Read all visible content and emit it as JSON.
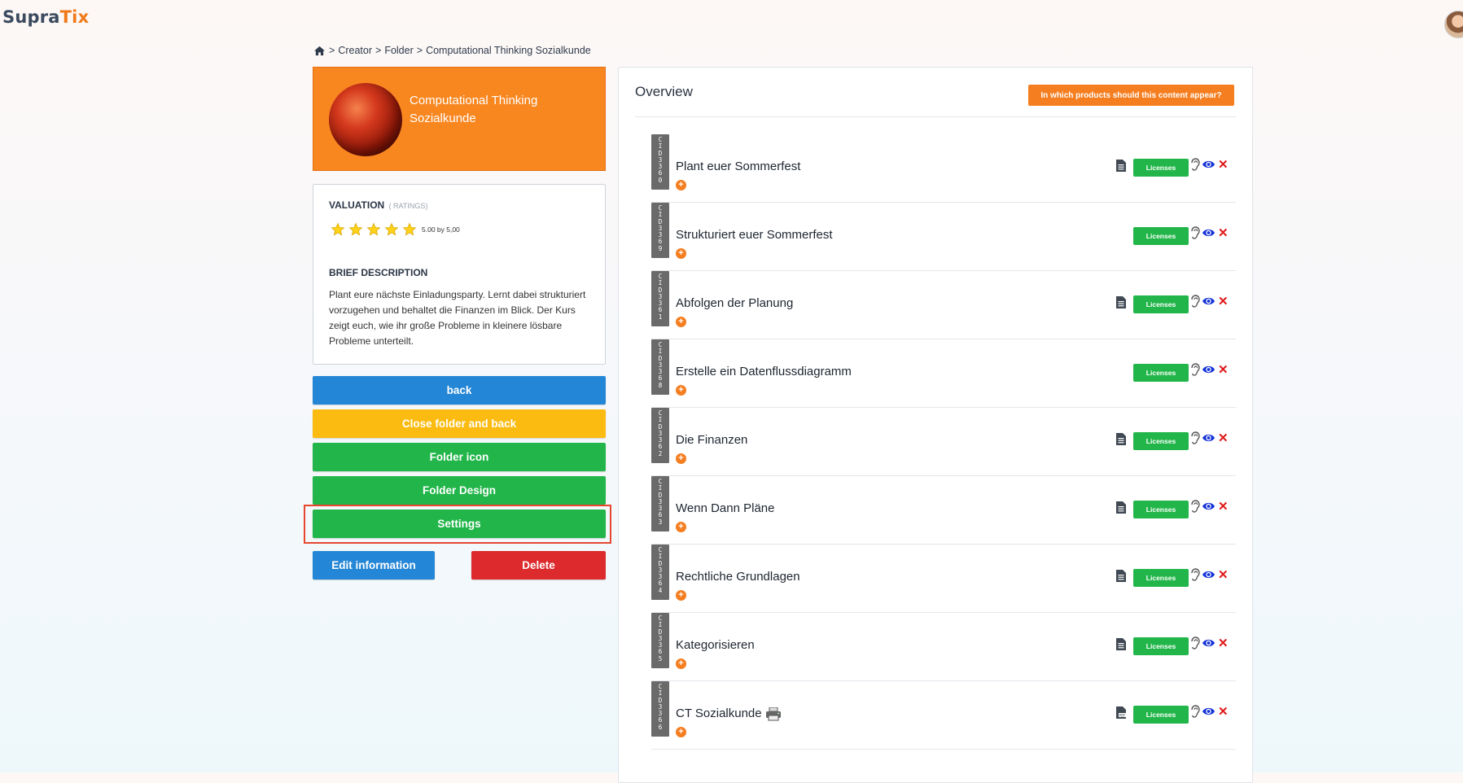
{
  "header": {
    "logo_part1": "Supra",
    "logo_part2": "Tix"
  },
  "breadcrumb": {
    "items": [
      "Creator",
      "Folder",
      "Computational Thinking Sozialkunde"
    ],
    "separator": ">"
  },
  "folder": {
    "title": "Computational Thinking Sozialkunde",
    "valuation_label": "VALUATION",
    "ratings_label": "( RATINGS)",
    "stars": 5,
    "rating_text": "5.00 by 5,00",
    "brief_label": "BRIEF DESCRIPTION",
    "description": "Plant eure nächste Einladungsparty. Lernt dabei strukturiert vorzugehen und behaltet die Finanzen im Blick. Der Kurs zeigt euch, wie ihr große Probleme in kleinere lösbare Probleme unterteilt."
  },
  "buttons": {
    "back": "back",
    "close_folder": "Close folder and back",
    "folder_icon": "Folder icon",
    "folder_design": "Folder Design",
    "settings": "Settings",
    "edit_info": "Edit information",
    "delete": "Delete"
  },
  "overview": {
    "title": "Overview",
    "products_button": "In which products should this content appear?",
    "licenses_label": "Licenses",
    "items": [
      {
        "cid": "CID3360",
        "title": "Plant euer Sommerfest",
        "doc": "file"
      },
      {
        "cid": "CID3369",
        "title": "Strukturiert euer Sommerfest",
        "doc": "none"
      },
      {
        "cid": "CID3361",
        "title": "Abfolgen der Planung",
        "doc": "file"
      },
      {
        "cid": "CID3368",
        "title": "Erstelle ein Datenflussdiagramm",
        "doc": "none"
      },
      {
        "cid": "CID3362",
        "title": "Die Finanzen",
        "doc": "file"
      },
      {
        "cid": "CID3363",
        "title": "Wenn Dann Pläne",
        "doc": "file"
      },
      {
        "cid": "CID3364",
        "title": "Rechtliche Grundlagen",
        "doc": "file"
      },
      {
        "cid": "CID3365",
        "title": "Kategorisieren",
        "doc": "file"
      },
      {
        "cid": "CID3366",
        "title": "CT Sozialkunde",
        "doc": "pdf",
        "printer": true
      }
    ]
  },
  "colors": {
    "orange": "#f98720",
    "green": "#22b64a",
    "blue": "#2386d6",
    "yellow": "#fbbb10",
    "red": "#dc2a2d"
  }
}
